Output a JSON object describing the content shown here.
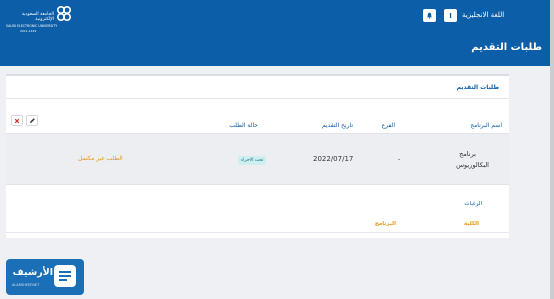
{
  "header": {
    "logo_ar": "الجامعة السعودية الإلكترونية",
    "logo_en": "SAUDI ELECTRONIC UNIVERSITY",
    "logo_est": "2011-1432",
    "lang_label": "اللغة الانجليزية",
    "lang_button": "I",
    "bell_icon": "bell-icon",
    "page_title": "طلبات التقديم"
  },
  "card": {
    "title": "طلبات التقديم",
    "columns": [
      "اسم البرنامج",
      "الفرع",
      "تاريخ التقديم",
      "حالة الطلب"
    ],
    "row": {
      "program_line1": "برنامج",
      "program_line2": "البكالوريوس",
      "branch": "-",
      "date": "2022/07/17",
      "status_badge": "تحت الاجراء",
      "status_note": "الطلب غير مكتمل"
    },
    "actions": {
      "edit_icon": "pencil-icon",
      "delete_icon": "close-icon"
    }
  },
  "preferences": {
    "title": "الرغبات",
    "col_college": "الكلية",
    "col_program": "البرنامج"
  },
  "watermark": {
    "text": "الأرشيف",
    "url": "ALARSHEEF.NET",
    "icon": "document-icon"
  },
  "colors": {
    "primary": "#0d5ea8",
    "warning": "#e09a1a",
    "badge_bg": "#cfeef0"
  }
}
